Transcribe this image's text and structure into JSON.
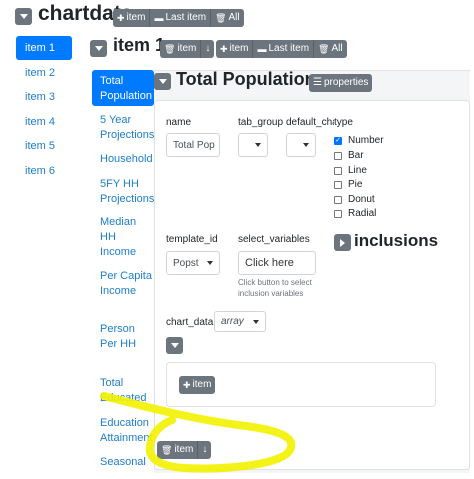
{
  "root": {
    "title": "chartdata",
    "toolbar": {
      "add_item": "item",
      "last_item": "Last item",
      "all": "All"
    }
  },
  "nav": {
    "items": [
      "item 1",
      "item 2",
      "item 3",
      "item 4",
      "item 5",
      "item 6"
    ]
  },
  "item": {
    "title": "item 1",
    "toolbar": {
      "delete": "item",
      "add_item": "item",
      "last_item": "Last item",
      "all": "All"
    }
  },
  "subnav": {
    "items": [
      "Total Population",
      "5 Year Projections",
      "Household",
      "5FY HH Projections",
      "Median HH Income",
      "Per Capita Income",
      "Person Per HH",
      "Total Educated",
      "Education Attainment",
      "Seasonal"
    ]
  },
  "detail": {
    "title": "Total Population",
    "properties_label": "properties",
    "fields": {
      "name_label": "name",
      "name_value": "Total Pop",
      "tab_group_label": "tab_group",
      "default_chart_label": "default_chart",
      "type_label": "type",
      "template_id_label": "template_id",
      "template_id_value": "Popst",
      "select_variables_label": "select_variables",
      "select_variables_button": "Click here",
      "select_variables_help": "Click button to select inclusion variables",
      "chart_data_label": "chart_data",
      "chart_data_value": "array"
    },
    "type_options": [
      {
        "label": "Number",
        "checked": true
      },
      {
        "label": "Bar",
        "checked": false
      },
      {
        "label": "Line",
        "checked": false
      },
      {
        "label": "Pie",
        "checked": false
      },
      {
        "label": "Donut",
        "checked": false
      },
      {
        "label": "Radial",
        "checked": false
      }
    ],
    "inclusions_title": "inclusions",
    "add_item_button": "item",
    "bottom_toolbar": {
      "delete": "item"
    }
  },
  "colors": {
    "accent": "#007bff",
    "link": "#1e7ec8",
    "button": "#6c757d",
    "highlight": "#f2f200"
  }
}
